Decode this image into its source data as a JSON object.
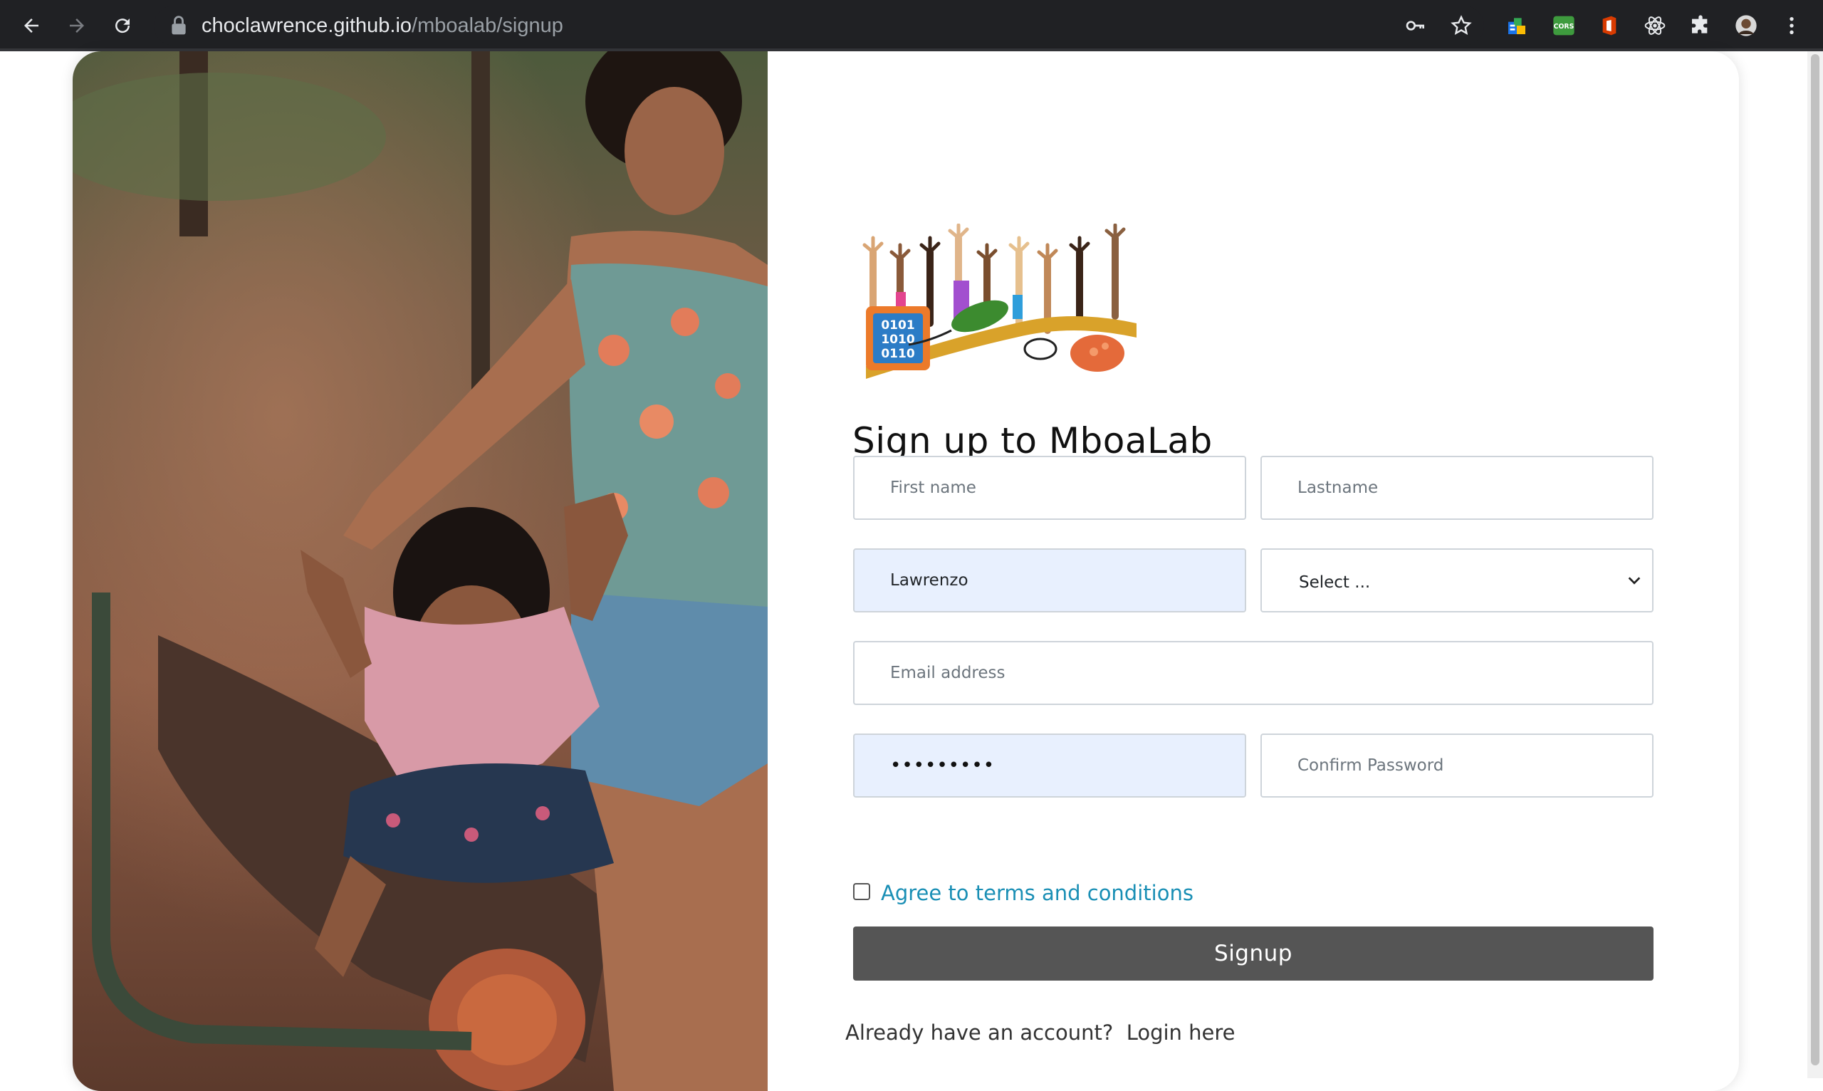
{
  "browser": {
    "url_host": "choclawrence.github.io",
    "url_path": "/mboalab/signup",
    "icons": [
      "back-arrow-icon",
      "forward-arrow-icon",
      "reload-icon",
      "lock-icon",
      "key-icon",
      "star-icon",
      "extension-icon",
      "cors-extension-icon",
      "office-icon",
      "react-devtools-icon",
      "puzzle-icon",
      "profile-avatar",
      "kebab-menu-icon"
    ],
    "cors_label": "CORS"
  },
  "signup": {
    "title": "Sign up to MboaLab",
    "logo_text": [
      "0101",
      "1010",
      "0110"
    ],
    "fields": {
      "first_name": {
        "placeholder": "First name",
        "value": ""
      },
      "last_name": {
        "placeholder": "Lastname",
        "value": ""
      },
      "username": {
        "value": "Lawrenzo"
      },
      "select": {
        "selected": "Select ..."
      },
      "email": {
        "placeholder": "Email address",
        "value": ""
      },
      "password": {
        "value": "•••••••••"
      },
      "confirm_password": {
        "placeholder": "Confirm Password",
        "value": ""
      }
    },
    "terms_label": "Agree to terms and conditions",
    "submit_label": "Signup",
    "already_text": "Already have an account?",
    "login_link": "Login here"
  },
  "colors": {
    "chrome_bg": "#202124",
    "autofill_bg": "#e8f0fe",
    "button_bg": "#555555",
    "link_color": "#1a8fb5"
  }
}
